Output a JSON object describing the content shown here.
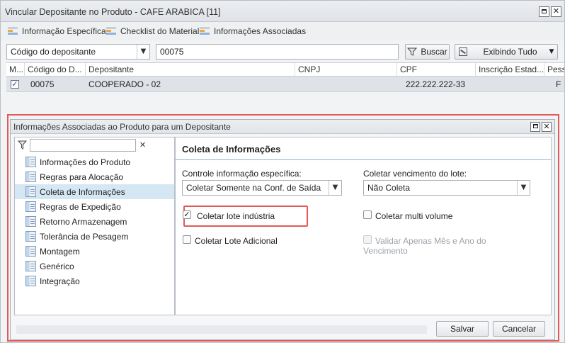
{
  "window": {
    "title": "Vincular Depositante no Produto - CAFE ARABICA [11]",
    "restore_glyph": "▭",
    "close_glyph": "✕"
  },
  "tabs": [
    {
      "label": "Informação Específica",
      "icon": "table-icon"
    },
    {
      "label": "Checklist do Material",
      "icon": "table-icon"
    },
    {
      "label": "Informações Associadas",
      "icon": "table-icon"
    }
  ],
  "search": {
    "field_select": "Código do depositante",
    "value": "00075",
    "search_button": "Buscar",
    "view_button": "Exibindo Tudo",
    "caret": "▼"
  },
  "grid": {
    "columns": [
      "M...",
      "Código do D...",
      "Depositante",
      "CNPJ",
      "CPF",
      "Inscrição Estad...",
      "Pess"
    ],
    "rows": [
      {
        "checked": "✓",
        "codigo": "00075",
        "depositante": "COOPERADO - 02",
        "cnpj": "",
        "cpf": "222.222.222-33",
        "inscricao": "",
        "pessoa": "F"
      }
    ]
  },
  "dialog": {
    "title": "Informações Associadas ao Produto para um Depositante",
    "filter_clear": "✕",
    "tree": [
      {
        "label": "Informações do Produto",
        "selected": false
      },
      {
        "label": "Regras para Alocação",
        "selected": false
      },
      {
        "label": "Coleta de Informações",
        "selected": true
      },
      {
        "label": "Regras de Expedição",
        "selected": false
      },
      {
        "label": "Retorno Armazenagem",
        "selected": false
      },
      {
        "label": "Tolerância de Pesagem",
        "selected": false
      },
      {
        "label": "Montagem",
        "selected": false
      },
      {
        "label": "Genérico",
        "selected": false
      },
      {
        "label": "Integração",
        "selected": false
      }
    ],
    "panel": {
      "title": "Coleta de Informações",
      "controle_label": "Controle informação específica:",
      "controle_value": "Coletar Somente na Conf. de Saída",
      "vencimento_label": "Coletar vencimento do lote:",
      "vencimento_value": "Não Coleta",
      "checks": {
        "lote_industria": {
          "label": "Coletar lote indústria",
          "checked": true,
          "mark": "✓"
        },
        "multi_volume": {
          "label": "Coletar multi volume",
          "checked": false
        },
        "lote_adicional": {
          "label": "Coletar Lote Adicional",
          "checked": false
        },
        "validar_mes_ano": {
          "label": "Validar Apenas Mês e Ano do Vencimento",
          "checked": false,
          "disabled": true
        }
      }
    },
    "buttons": {
      "save": "Salvar",
      "cancel": "Cancelar"
    }
  },
  "colors": {
    "highlight_border": "#e05a5a",
    "selected_tree_item": "#d6e7f4",
    "panel_rule": "#8fb2d8"
  }
}
